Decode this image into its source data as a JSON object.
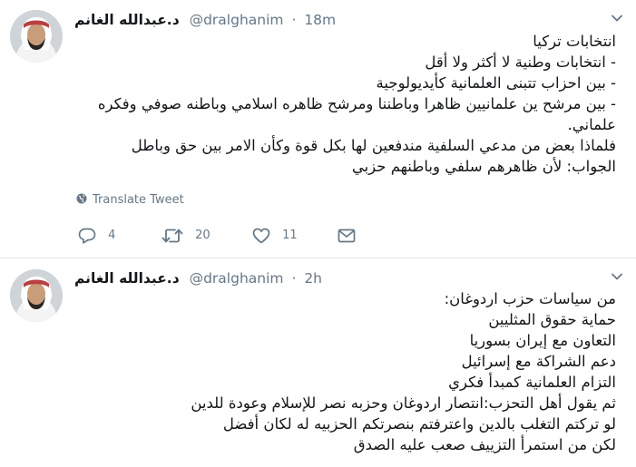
{
  "tweets": [
    {
      "author_name": "د.عبدالله الغانم",
      "handle": "@dralghanim",
      "separator": "·",
      "time": "18m",
      "lines": [
        "انتخابات تركيا",
        "- انتخابات وطنية لا أكثر ولا أقل",
        "- بين احزاب تتبنى العلمانية كأيديولوجية",
        "- بين مرشح ين علمانيين ظاهرا وباطننا ومرشح ظاهره اسلامي وباطنه صوفي وفكره",
        "علماني.",
        "فلماذا بعض من مدعي السلفية مندفعين لها بكل قوة وكأن الامر بين حق وباطل",
        "الجواب: لأن ظاهرهم سلفي وباطنهم حزبي"
      ],
      "translate_label": "Translate Tweet",
      "reply_count": "4",
      "retweet_count": "20",
      "like_count": "11"
    },
    {
      "author_name": "د.عبدالله الغانم",
      "handle": "@dralghanim",
      "separator": "·",
      "time": "2h",
      "lines": [
        "من سياسات حزب اردوغان:",
        "حماية حقوق المثليين",
        "التعاون مع إيران بسوريا",
        "دعم الشراكة مع إسرائيل",
        "التزام العلمانية كمبدأ فكري",
        "ثم يقول أهل التحزب:انتصار اردوغان وحزبه نصر للإسلام وعودة للدين",
        "لو تركتم التغلب بالدين واعترفتم بنصرتكم الحزبيه له لكان أفضل",
        "لكن من استمرأ التزييف صعب عليه الصدق"
      ]
    }
  ],
  "icons": {
    "caret": "chevron-down-icon",
    "globe": "globe-icon",
    "reply": "reply-icon",
    "retweet": "retweet-icon",
    "like": "heart-icon",
    "dm": "envelope-icon"
  },
  "colors": {
    "text": "#14171a",
    "muted": "#657786",
    "divider": "#e6ecf0"
  }
}
